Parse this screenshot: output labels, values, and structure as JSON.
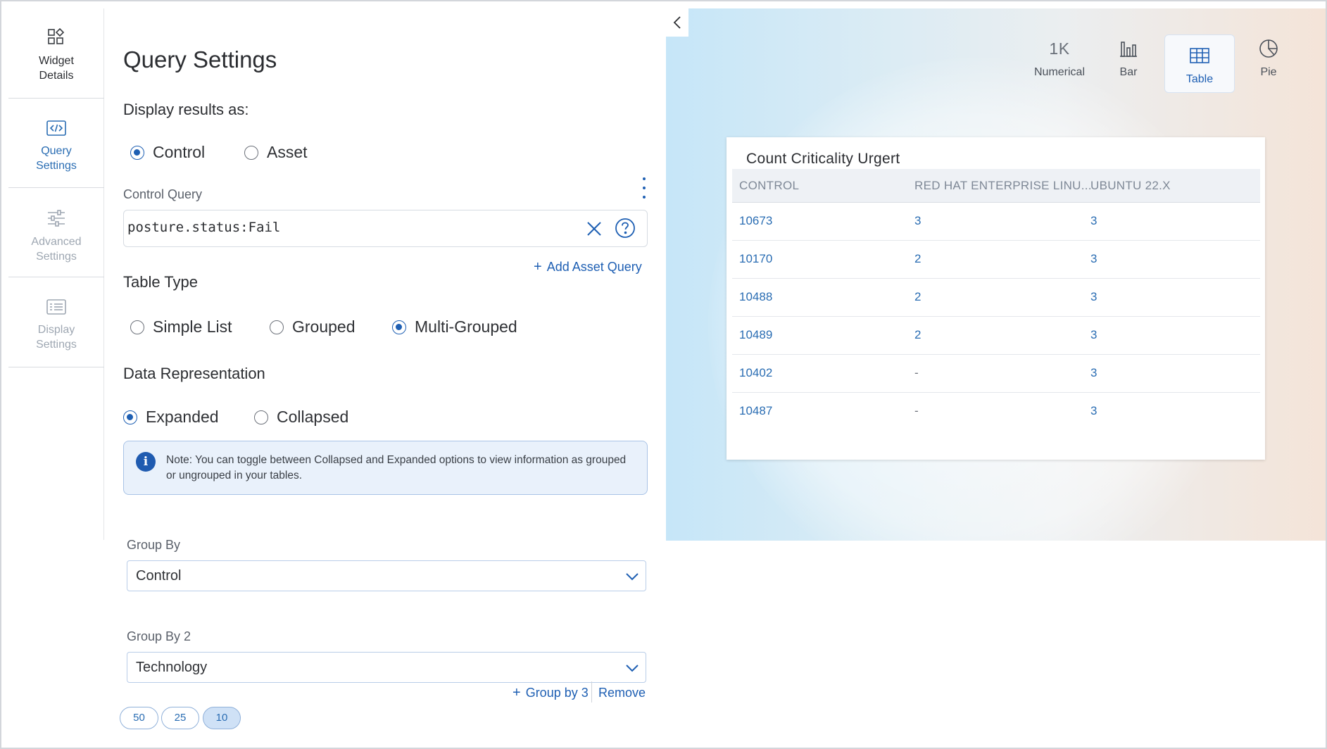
{
  "nav": {
    "items": [
      {
        "label": "Widget\nDetails",
        "icon": "shapes-icon"
      },
      {
        "label": "Query\nSettings",
        "icon": "code-icon"
      },
      {
        "label": "Advanced\nSettings",
        "icon": "sliders-icon"
      },
      {
        "label": "Display\nSettings",
        "icon": "list-icon"
      }
    ]
  },
  "panel": {
    "title": "Query Settings",
    "display_results_as": {
      "label": "Display results as:",
      "options": [
        "Control",
        "Asset"
      ],
      "selected": "Control"
    },
    "control_query": {
      "label": "Control Query",
      "value": "posture.status:Fail"
    },
    "add_asset_query": "Add Asset Query",
    "table_type": {
      "label": "Table Type",
      "options": [
        "Simple List",
        "Grouped",
        "Multi-Grouped"
      ],
      "selected": "Multi-Grouped"
    },
    "data_representation": {
      "label": "Data Representation",
      "options": [
        "Expanded",
        "Collapsed"
      ],
      "selected": "Expanded"
    },
    "note": "Note: You can toggle between Collapsed and Expanded options to view information as grouped or ungrouped in your tables.",
    "group_by": {
      "label": "Group By",
      "value": "Control"
    },
    "group_by_2": {
      "label": "Group By 2",
      "value": "Technology"
    },
    "group_by_3": "Group by 3",
    "remove": "Remove",
    "page_sizes": [
      "50",
      "25",
      "10"
    ],
    "page_size_selected": "10"
  },
  "preview": {
    "chart_types": [
      {
        "label": "Numerical",
        "icon": "numerical-icon",
        "glyph": "1K"
      },
      {
        "label": "Bar",
        "icon": "bar-chart-icon"
      },
      {
        "label": "Table",
        "icon": "table-icon"
      },
      {
        "label": "Pie",
        "icon": "pie-chart-icon"
      }
    ],
    "selected_type": "Table",
    "table": {
      "title": "Count Criticality Urgert",
      "columns": [
        "CONTROL",
        "RED HAT ENTERPRISE LINU...",
        "UBUNTU 22.X"
      ],
      "rows": [
        [
          "10673",
          "3",
          "3"
        ],
        [
          "10170",
          "2",
          "3"
        ],
        [
          "10488",
          "2",
          "3"
        ],
        [
          "10489",
          "2",
          "3"
        ],
        [
          "10402",
          "-",
          "3"
        ],
        [
          "10487",
          "-",
          "3"
        ]
      ]
    }
  },
  "colors": {
    "accent": "#1e5fb3",
    "link": "#2a6db3",
    "note_bg": "#e9f1fb",
    "info_icon": "#1f5bb0"
  }
}
